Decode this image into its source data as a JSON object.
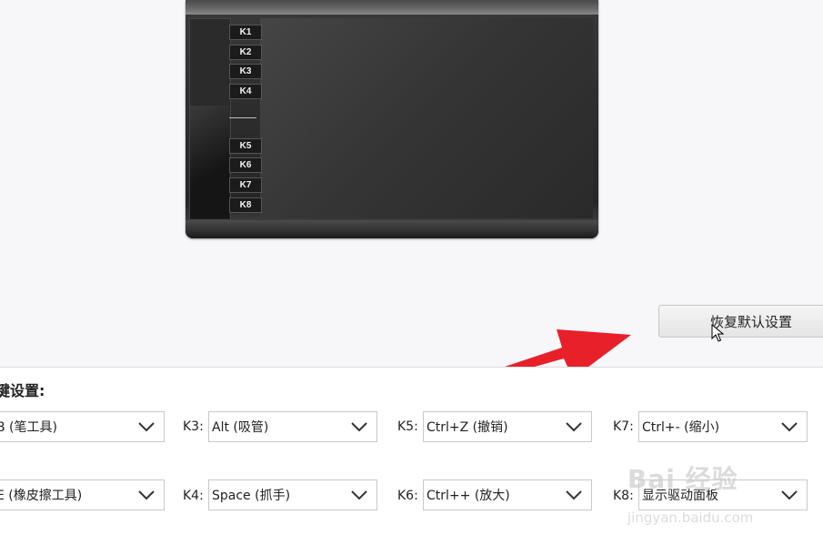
{
  "tablet": {
    "keys_top": [
      "K1",
      "K2",
      "K3",
      "K4"
    ],
    "keys_bottom": [
      "K5",
      "K6",
      "K7",
      "K8"
    ]
  },
  "restore_button": {
    "label": "恢复默认设置"
  },
  "section_title": "键设置:",
  "key_settings": [
    {
      "key": "",
      "value": "B (笔工具)"
    },
    {
      "key": "",
      "value": "E (橡皮擦工具)"
    },
    {
      "key": "K3:",
      "value": "Alt (吸管)"
    },
    {
      "key": "K4:",
      "value": "Space (抓手)"
    },
    {
      "key": "K5:",
      "value": "Ctrl+Z (撤销)"
    },
    {
      "key": "K6:",
      "value": "Ctrl++ (放大)"
    },
    {
      "key": "K7:",
      "value": "Ctrl+- (缩小)"
    },
    {
      "key": "K8:",
      "value": "显示驱动面板"
    }
  ],
  "watermark": {
    "main": "Bai 经验",
    "sub": "jingyan.baidu.com"
  },
  "colors": {
    "arrow": "#e8202a"
  }
}
